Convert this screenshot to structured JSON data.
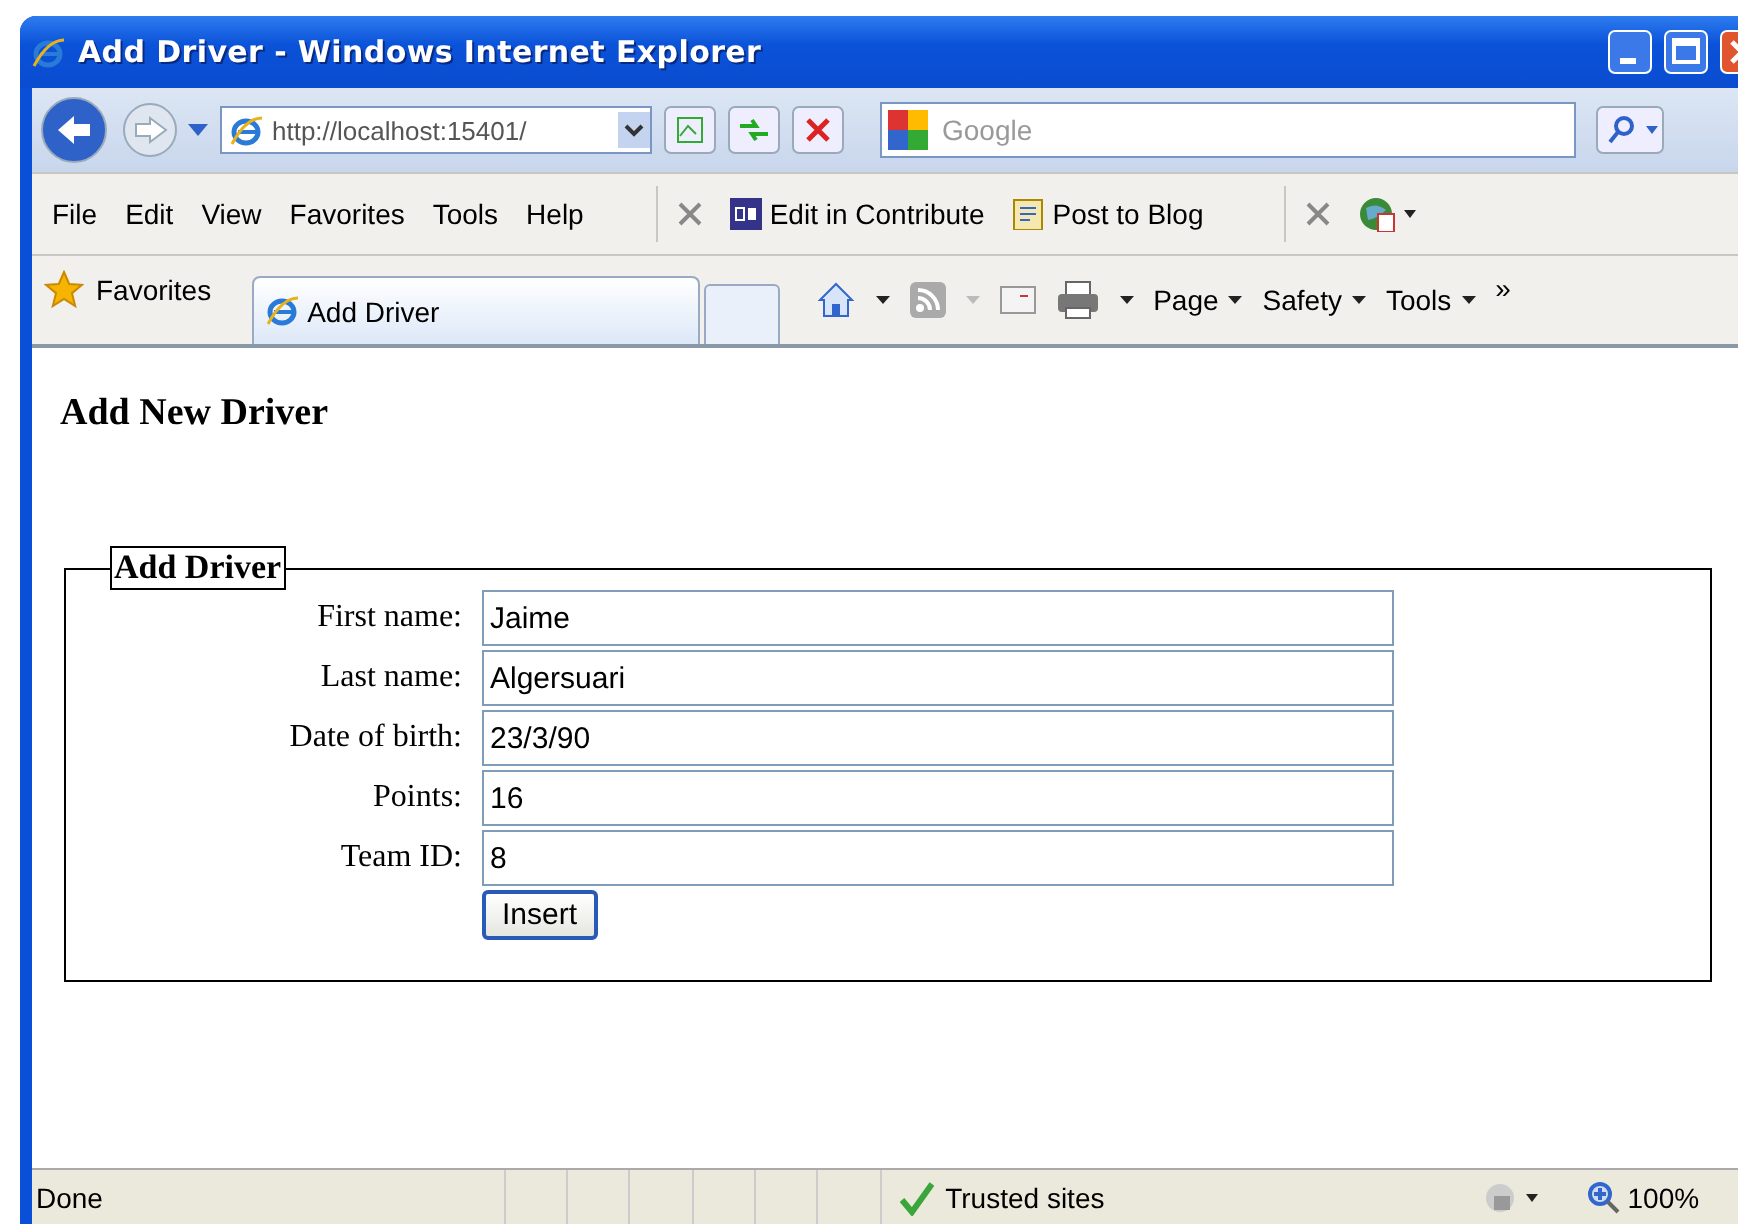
{
  "window": {
    "title": "Add Driver - Windows Internet Explorer"
  },
  "address_bar": {
    "url": "http://localhost:15401/"
  },
  "search": {
    "placeholder": "Google"
  },
  "menu": [
    "File",
    "Edit",
    "View",
    "Favorites",
    "Tools",
    "Help"
  ],
  "links_toolbar": [
    {
      "label": "Edit in Contribute",
      "kind": "contribute"
    },
    {
      "label": "Post to Blog",
      "kind": "blog"
    }
  ],
  "favorites": {
    "label": "Favorites"
  },
  "tabs": [
    {
      "label": "Add Driver",
      "selected": true
    }
  ],
  "command_bar": [
    "Page",
    "Safety",
    "Tools"
  ],
  "chevron": "»",
  "page": {
    "heading": "Add New Driver",
    "legend": "Add Driver",
    "fields": [
      {
        "label": "First name:",
        "value": "Jaime"
      },
      {
        "label": "Last name:",
        "value": "Algersuari"
      },
      {
        "label": "Date of birth:",
        "value": "23/3/90"
      },
      {
        "label": "Points:",
        "value": "16"
      },
      {
        "label": "Team ID:",
        "value": "8"
      }
    ],
    "button": "Insert"
  },
  "status_bar": {
    "text": "Done",
    "zone": "Trusted sites",
    "zoom": "100%"
  }
}
